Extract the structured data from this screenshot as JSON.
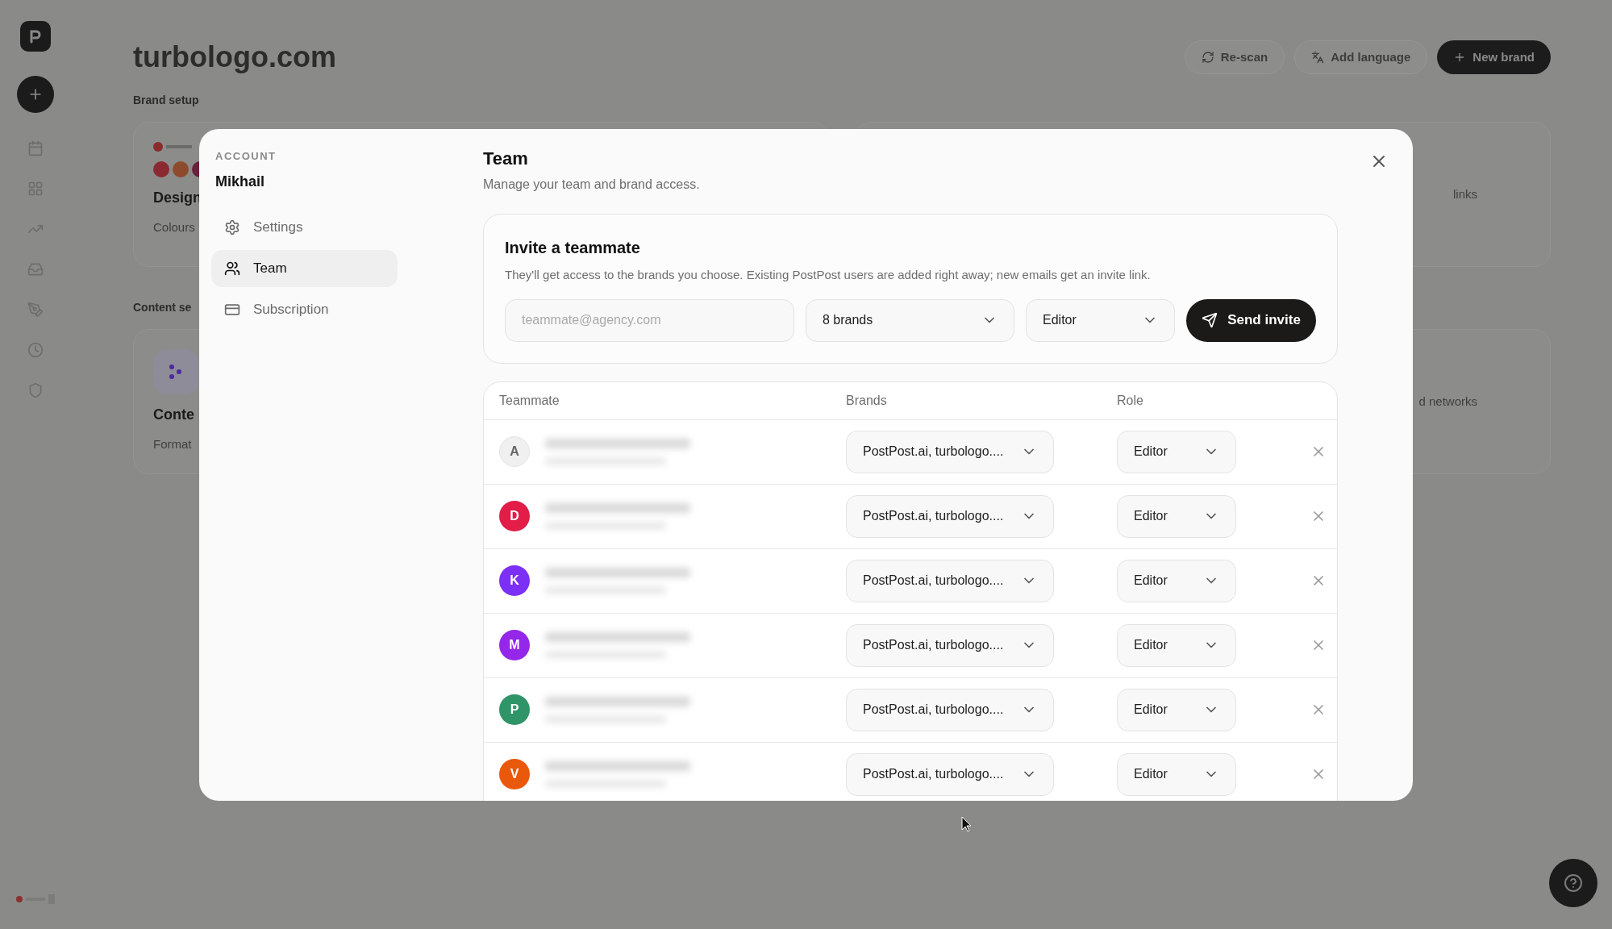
{
  "page": {
    "title": "turbologo.com",
    "section_label": "Brand setup",
    "second_section_label": "Content se",
    "actions": [
      {
        "label": "Re-scan",
        "kind": "rescan"
      },
      {
        "label": "Add language",
        "kind": "language"
      },
      {
        "label": "New brand",
        "kind": "primary"
      }
    ],
    "cards": [
      {
        "title": "Design",
        "subtitle": "Colours",
        "side_text": "links",
        "kind": "swatches"
      },
      {
        "title": "Conte",
        "subtitle": "Format",
        "side_text": "d networks",
        "kind": "content"
      }
    ]
  },
  "modal": {
    "account_label": "ACCOUNT",
    "account_name": "Mikhail",
    "nav": [
      {
        "label": "Settings",
        "kind": "settings",
        "selected": false
      },
      {
        "label": "Team",
        "kind": "team",
        "selected": true
      },
      {
        "label": "Subscription",
        "kind": "subscription",
        "selected": false
      }
    ],
    "title": "Team",
    "subtitle": "Manage your team and brand access.",
    "invite": {
      "title": "Invite a teammate",
      "description": "They'll get access to the brands you choose. Existing PostPost users are added right away; new emails get an invite link.",
      "email_placeholder": "teammate@agency.com",
      "brands": "8 brands",
      "role": "Editor",
      "button": "Send invite"
    },
    "table": {
      "columns": [
        "Teammate",
        "Brands",
        "Role"
      ],
      "rows": [
        {
          "initial": "A",
          "color": "#f0f0f0",
          "brands": "PostPost.ai, turbologo....",
          "role": "Editor"
        },
        {
          "initial": "D",
          "color": "#e11d48",
          "brands": "PostPost.ai, turbologo....",
          "role": "Editor"
        },
        {
          "initial": "K",
          "color": "#7c2ff5",
          "brands": "PostPost.ai, turbologo....",
          "role": "Editor"
        },
        {
          "initial": "M",
          "color": "#9427ea",
          "brands": "PostPost.ai, turbologo....",
          "role": "Editor"
        },
        {
          "initial": "P",
          "color": "#2f9467",
          "brands": "PostPost.ai, turbologo....",
          "role": "Editor"
        },
        {
          "initial": "V",
          "color": "#ea580c",
          "brands": "PostPost.ai, turbologo....",
          "role": "Editor"
        }
      ]
    }
  }
}
